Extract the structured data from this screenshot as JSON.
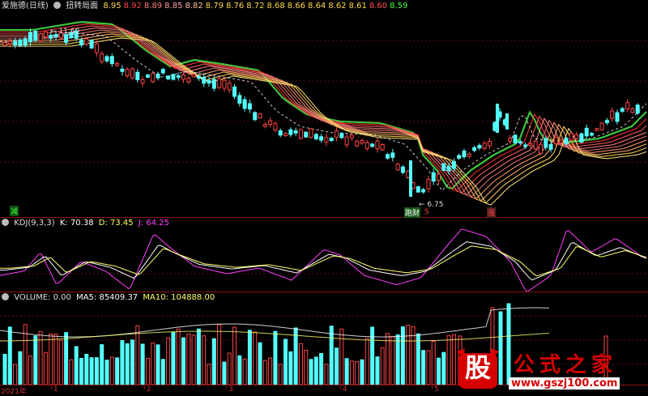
{
  "main": {
    "app_name": "爱施德(日线)",
    "indicator_name": "扭转局面",
    "ma_values": [
      {
        "v": "8.95",
        "c": "#ffd84a"
      },
      {
        "v": "8.92",
        "c": "#ff4040"
      },
      {
        "v": "8.89",
        "c": "#ff7a7a"
      },
      {
        "v": "8.85",
        "c": "#ff9e9e"
      },
      {
        "v": "8.82",
        "c": "#ffc0a0"
      },
      {
        "v": "8.79",
        "c": "#ffd84a"
      },
      {
        "v": "8.76",
        "c": "#ffd84a"
      },
      {
        "v": "8.72",
        "c": "#ffd84a"
      },
      {
        "v": "8.68",
        "c": "#ffd84a"
      },
      {
        "v": "8.66",
        "c": "#ffd84a"
      },
      {
        "v": "8.64",
        "c": "#ffd84a"
      },
      {
        "v": "8.62",
        "c": "#ffd84a"
      },
      {
        "v": "8.61",
        "c": "#ffd84a"
      },
      {
        "v": "8.60",
        "c": "#ff5050"
      },
      {
        "v": "8.59",
        "c": "#40ff40"
      }
    ],
    "high_label": "11.60",
    "low_label": "6.75",
    "marker_jian": "减",
    "marker_gui": "跑财",
    "marker_s": "S",
    "marker_zhang": "涨"
  },
  "kdj": {
    "name": "KDJ(9,3,3)",
    "k_label": "K: 70.38",
    "d_label": "D: 73.45",
    "j_label": "J: 64.25"
  },
  "volume": {
    "name": "VOLUME: 0.00",
    "ma5_label": "MA5: 85409.37",
    "ma10_label": "MA10: 104888.00"
  },
  "xaxis": {
    "labels": [
      "2021年",
      "1",
      "2",
      "3",
      "4",
      "5"
    ]
  },
  "watermark": {
    "logo_char": "股",
    "title": "公式之家",
    "url": "www.gszj100.com"
  },
  "colors": {
    "up": "#ff4444",
    "down": "#54ffff",
    "k_line": "#ffffff",
    "d_line": "#ffff66",
    "j_line": "#ff40ff",
    "brand_red": "#d60000"
  }
}
